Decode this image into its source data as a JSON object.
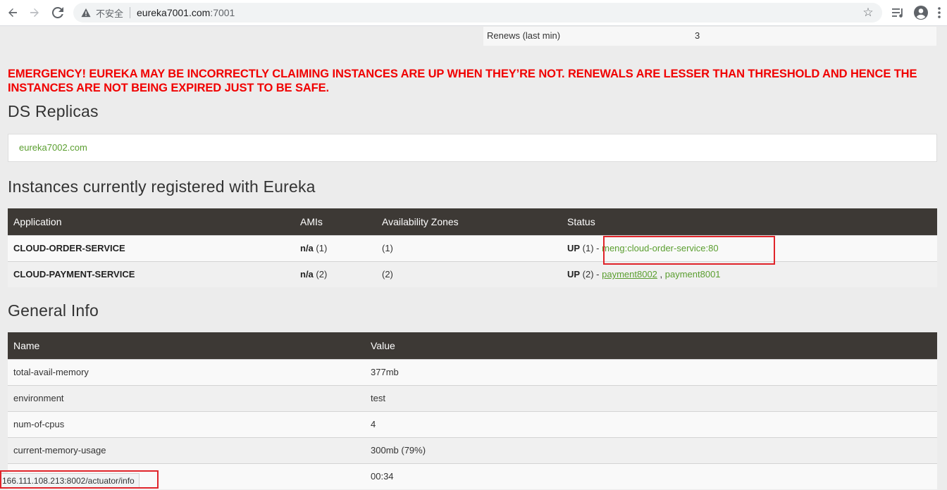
{
  "browser": {
    "insecure_label": "不安全",
    "url_host": "eureka7001.com",
    "url_port": ":7001"
  },
  "renews": {
    "label": "Renews (last min)",
    "value": "3"
  },
  "emergency_text": "EMERGENCY! EUREKA MAY BE INCORRECTLY CLAIMING INSTANCES ARE UP WHEN THEY’RE NOT. RENEWALS ARE LESSER THAN THRESHOLD AND HENCE THE INSTANCES ARE NOT BEING EXPIRED JUST TO BE SAFE.",
  "ds_replicas": {
    "title": "DS Replicas",
    "link": "eureka7002.com"
  },
  "instances": {
    "title": "Instances currently registered with Eureka",
    "headers": [
      "Application",
      "AMIs",
      "Availability Zones",
      "Status"
    ],
    "rows": [
      {
        "app": "CLOUD-ORDER-SERVICE",
        "ami_bold": "n/a",
        "ami_count": " (1)",
        "zones": "(1)",
        "status_up": "UP",
        "status_count": " (1) - ",
        "links": [
          "meng:cloud-order-service:80"
        ]
      },
      {
        "app": "CLOUD-PAYMENT-SERVICE",
        "ami_bold": "n/a",
        "ami_count": " (2)",
        "zones": "(2)",
        "status_up": "UP",
        "status_count": " (2) - ",
        "links": [
          "payment8002",
          "payment8001"
        ],
        "link_sep": " , "
      }
    ]
  },
  "general_info": {
    "title": "General Info",
    "headers": [
      "Name",
      "Value"
    ],
    "rows": [
      {
        "name": "total-avail-memory",
        "value": "377mb"
      },
      {
        "name": "environment",
        "value": "test"
      },
      {
        "name": "num-of-cpus",
        "value": "4"
      },
      {
        "name": "current-memory-usage",
        "value": "300mb (79%)"
      },
      {
        "name": "",
        "value": "00:34"
      }
    ]
  },
  "status_bar_url": "166.111.108.213:8002/actuator/info",
  "colors": {
    "accent_link": "#5a9e2f",
    "emergency": "#f00000",
    "header_bg": "#3d3935",
    "highlight": "#e0242a"
  }
}
